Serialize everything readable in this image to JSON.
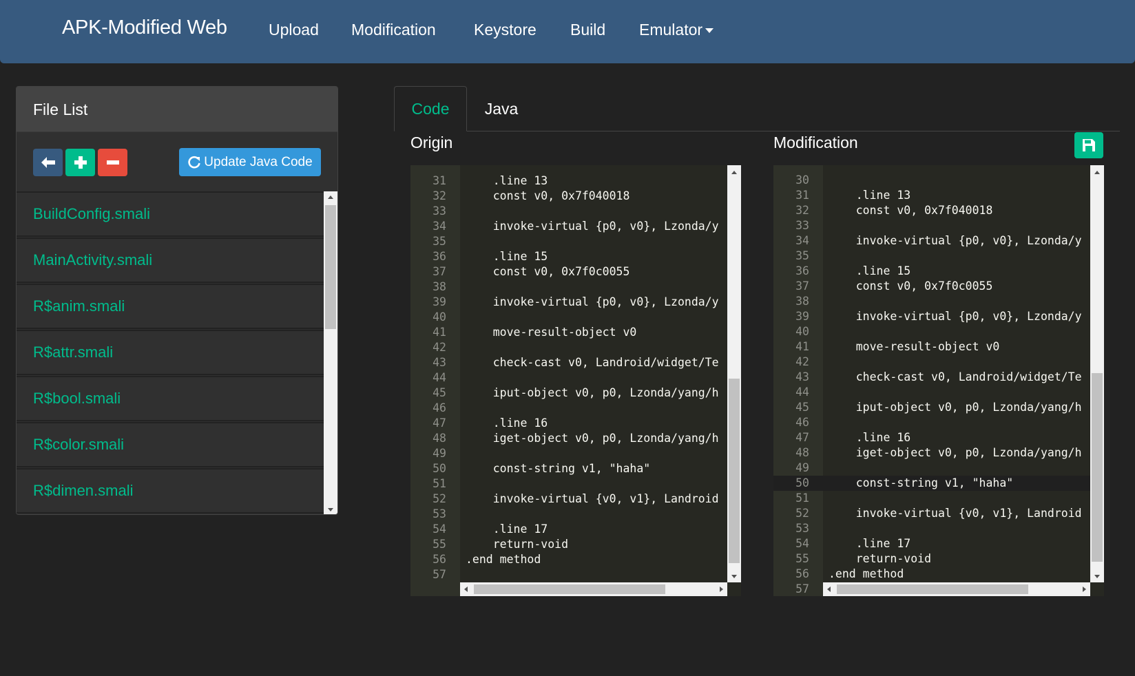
{
  "navbar": {
    "brand": "APK-Modified Web",
    "items": [
      "Upload",
      "Modification",
      "Keystore",
      "Build",
      "Emulator"
    ]
  },
  "file_panel": {
    "title": "File List",
    "update_button": "Update Java Code",
    "files": [
      "BuildConfig.smali",
      "MainActivity.smali",
      "R$anim.smali",
      "R$attr.smali",
      "R$bool.smali",
      "R$color.smali",
      "R$dimen.smali"
    ]
  },
  "tabs": [
    "Code",
    "Java"
  ],
  "origin": {
    "label": "Origin",
    "lines": [
      {
        "n": "31",
        "t": "    .line 13"
      },
      {
        "n": "32",
        "t": "    const v0, 0x7f040018"
      },
      {
        "n": "33",
        "t": ""
      },
      {
        "n": "34",
        "t": "    invoke-virtual {p0, v0}, Lzonda/y"
      },
      {
        "n": "35",
        "t": ""
      },
      {
        "n": "36",
        "t": "    .line 15"
      },
      {
        "n": "37",
        "t": "    const v0, 0x7f0c0055"
      },
      {
        "n": "38",
        "t": ""
      },
      {
        "n": "39",
        "t": "    invoke-virtual {p0, v0}, Lzonda/y"
      },
      {
        "n": "40",
        "t": ""
      },
      {
        "n": "41",
        "t": "    move-result-object v0"
      },
      {
        "n": "42",
        "t": ""
      },
      {
        "n": "43",
        "t": "    check-cast v0, Landroid/widget/Te"
      },
      {
        "n": "44",
        "t": ""
      },
      {
        "n": "45",
        "t": "    iput-object v0, p0, Lzonda/yang/h"
      },
      {
        "n": "46",
        "t": ""
      },
      {
        "n": "47",
        "t": "    .line 16"
      },
      {
        "n": "48",
        "t": "    iget-object v0, p0, Lzonda/yang/h"
      },
      {
        "n": "49",
        "t": ""
      },
      {
        "n": "50",
        "t": "    const-string v1, \"haha\""
      },
      {
        "n": "51",
        "t": ""
      },
      {
        "n": "52",
        "t": "    invoke-virtual {v0, v1}, Landroid"
      },
      {
        "n": "53",
        "t": ""
      },
      {
        "n": "54",
        "t": "    .line 17"
      },
      {
        "n": "55",
        "t": "    return-void"
      },
      {
        "n": "56",
        "t": ".end method"
      },
      {
        "n": "57",
        "t": ""
      }
    ]
  },
  "modification": {
    "label": "Modification",
    "lines": [
      {
        "n": "30",
        "t": ""
      },
      {
        "n": "31",
        "t": "    .line 13"
      },
      {
        "n": "32",
        "t": "    const v0, 0x7f040018"
      },
      {
        "n": "33",
        "t": ""
      },
      {
        "n": "34",
        "t": "    invoke-virtual {p0, v0}, Lzonda/y"
      },
      {
        "n": "35",
        "t": ""
      },
      {
        "n": "36",
        "t": "    .line 15"
      },
      {
        "n": "37",
        "t": "    const v0, 0x7f0c0055"
      },
      {
        "n": "38",
        "t": ""
      },
      {
        "n": "39",
        "t": "    invoke-virtual {p0, v0}, Lzonda/y"
      },
      {
        "n": "40",
        "t": ""
      },
      {
        "n": "41",
        "t": "    move-result-object v0"
      },
      {
        "n": "42",
        "t": ""
      },
      {
        "n": "43",
        "t": "    check-cast v0, Landroid/widget/Te"
      },
      {
        "n": "44",
        "t": ""
      },
      {
        "n": "45",
        "t": "    iput-object v0, p0, Lzonda/yang/h"
      },
      {
        "n": "46",
        "t": ""
      },
      {
        "n": "47",
        "t": "    .line 16"
      },
      {
        "n": "48",
        "t": "    iget-object v0, p0, Lzonda/yang/h"
      },
      {
        "n": "49",
        "t": ""
      },
      {
        "n": "50",
        "t": "    const-string v1, \"haha\""
      },
      {
        "n": "51",
        "t": ""
      },
      {
        "n": "52",
        "t": "    invoke-virtual {v0, v1}, Landroid"
      },
      {
        "n": "53",
        "t": ""
      },
      {
        "n": "54",
        "t": "    .line 17"
      },
      {
        "n": "55",
        "t": "    return-void"
      },
      {
        "n": "56",
        "t": ".end method"
      },
      {
        "n": "57",
        "t": ""
      }
    ]
  },
  "colors": {
    "navbar": "#375a7f",
    "accent": "#00bc8c",
    "danger": "#e74c3c",
    "info": "#3498db",
    "background": "#222222",
    "editor": "#272822"
  },
  "icons": {
    "back": "arrow-left-icon",
    "add": "plus-icon",
    "remove": "minus-icon",
    "update": "refresh-icon",
    "save": "floppy-disk-icon",
    "dropdown": "caret-down-icon"
  }
}
